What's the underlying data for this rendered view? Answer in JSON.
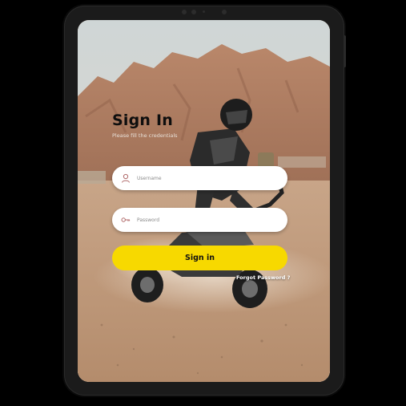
{
  "login": {
    "title": "Sign In",
    "subtitle": "Please fill the credentials",
    "username": {
      "placeholder": "Username",
      "value": "",
      "icon": "user-icon"
    },
    "password": {
      "placeholder": "Password",
      "value": "",
      "icon": "key-icon"
    },
    "submit_label": "Sign in",
    "forgot_label": "Forgot Password ?"
  },
  "colors": {
    "accent": "#f7d900",
    "field_bg": "#ffffff",
    "icon": "#b06a6a"
  }
}
